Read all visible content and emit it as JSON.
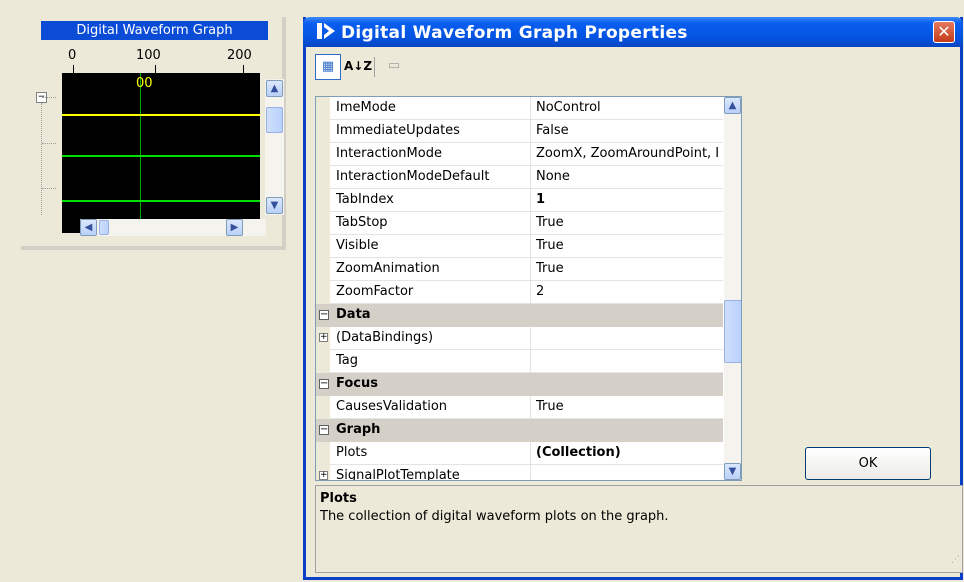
{
  "graph": {
    "caption": "Digital Waveform Graph",
    "x_ticks": [
      "0",
      "100",
      "200"
    ],
    "plot_value": "00",
    "colors": {
      "background": "#000000",
      "signal_top": "#ffff00",
      "signal": "#00e000",
      "cursor": "#00b000",
      "caption": "#0a4cd6"
    }
  },
  "dialog": {
    "title": "Digital Waveform Graph Properties",
    "title_icon": "play-arrow-icon",
    "close_label": "✕",
    "toolbar": {
      "categorized_label": "▦",
      "alphabetical_label": "A↓Z",
      "property_pages_label": "▭"
    },
    "rows": [
      {
        "kind": "prop",
        "name": "ImeMode",
        "value": "NoControl"
      },
      {
        "kind": "prop",
        "name": "ImmediateUpdates",
        "value": "False"
      },
      {
        "kind": "prop",
        "name": "InteractionMode",
        "value": "ZoomX, ZoomAroundPoint, I"
      },
      {
        "kind": "prop",
        "name": "InteractionModeDefault",
        "value": "None"
      },
      {
        "kind": "prop",
        "name": "TabIndex",
        "value": "1",
        "bold": true
      },
      {
        "kind": "prop",
        "name": "TabStop",
        "value": "True"
      },
      {
        "kind": "prop",
        "name": "Visible",
        "value": "True"
      },
      {
        "kind": "prop",
        "name": "ZoomAnimation",
        "value": "True"
      },
      {
        "kind": "prop",
        "name": "ZoomFactor",
        "value": "2"
      },
      {
        "kind": "category",
        "name": "Data",
        "expander": "⊟"
      },
      {
        "kind": "prop",
        "name": "(DataBindings)",
        "value": "",
        "expander": "⊞"
      },
      {
        "kind": "prop",
        "name": "Tag",
        "value": ""
      },
      {
        "kind": "category",
        "name": "Focus",
        "expander": "⊟"
      },
      {
        "kind": "prop",
        "name": "CausesValidation",
        "value": "True"
      },
      {
        "kind": "category",
        "name": "Graph",
        "expander": "⊟"
      },
      {
        "kind": "prop",
        "name": "Plots",
        "value": "(Collection)",
        "bold": true
      },
      {
        "kind": "prop",
        "name": "SignalPlotTemplate",
        "value": "",
        "expander": "⊞"
      }
    ],
    "help": {
      "title": "Plots",
      "text": "The collection of digital waveform plots on the graph."
    },
    "ok_label": "OK"
  },
  "icons": {
    "scroll_up": "▲",
    "scroll_down": "▼",
    "scroll_left": "◀",
    "scroll_right": "▶",
    "tree_collapse": "−"
  }
}
